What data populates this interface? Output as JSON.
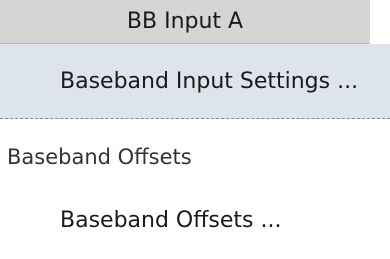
{
  "header": {
    "title": "BB Input A"
  },
  "settings": {
    "button_label": "Baseband Input Settings ..."
  },
  "offsets": {
    "section_label": "Baseband Offsets",
    "button_label": "Baseband Offsets ..."
  }
}
